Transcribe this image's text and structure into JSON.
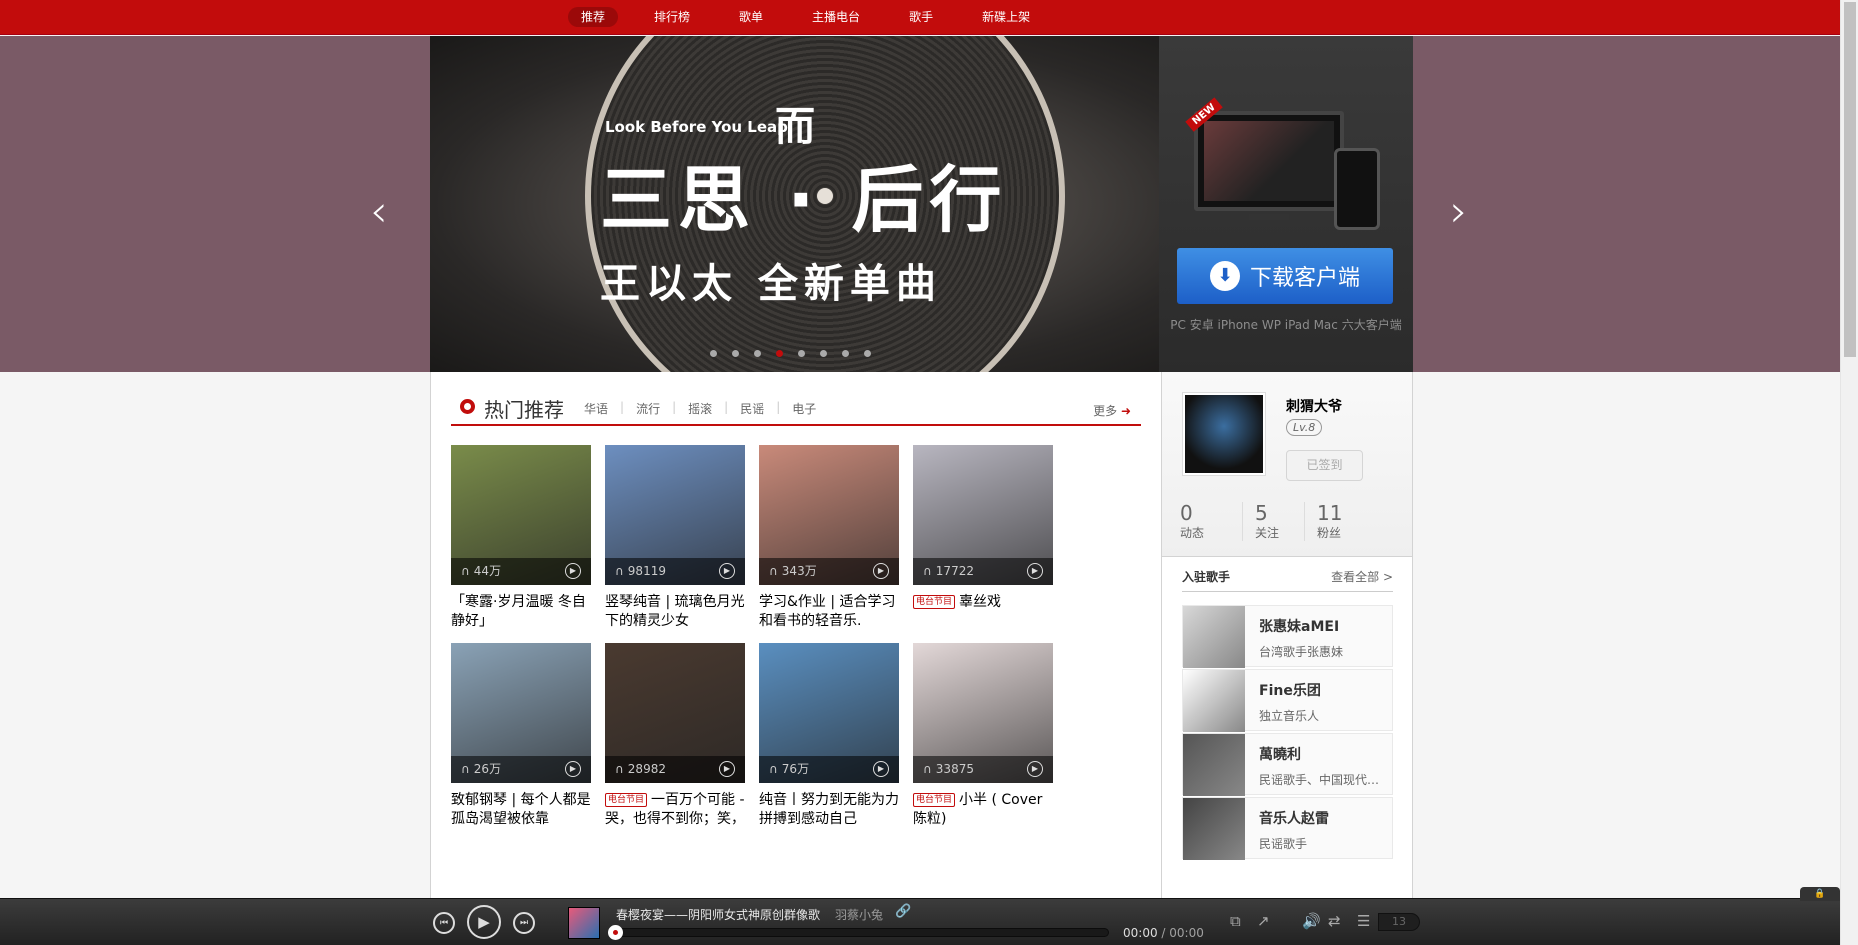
{
  "subnav": {
    "items": [
      "推荐",
      "排行榜",
      "歌单",
      "主播电台",
      "歌手",
      "新碟上架"
    ]
  },
  "banner": {
    "en_text": "Look Before You Leap",
    "er_text": "而",
    "main_text": "三思 · 后行",
    "sub_text": "王以太  全新单曲",
    "prev_arrow": "‹",
    "next_arrow": "›",
    "new_tag": "NEW",
    "download_label": "下载客户端",
    "download_icon": "⬇",
    "download_note": "PC 安卓 iPhone WP iPad Mac 六大客户端",
    "dots": 8,
    "active_dot": 3
  },
  "hot": {
    "title": "热门推荐",
    "tabs": [
      "华语",
      "流行",
      "摇滚",
      "民谣",
      "电子"
    ],
    "more": "更多",
    "more_arrow": "➜",
    "headphone_icon": "∩",
    "play_icon": "▶",
    "radio_tag": "电台节目",
    "cards": [
      {
        "count": "44万",
        "caption": "「寒露·岁月温暖 冬自静好」",
        "radio": false,
        "color": "#7a8c4a"
      },
      {
        "count": "98119",
        "caption": "竖琴纯音 | 琉璃色月光下的精灵少女",
        "radio": false,
        "color": "#6d8fc0"
      },
      {
        "count": "343万",
        "caption": "学习&作业 | 适合学习和看书的轻音乐.",
        "radio": false,
        "color": "#c98a7a"
      },
      {
        "count": "17722",
        "caption": "辜丝戏",
        "radio": true,
        "color": "#b8b6c0"
      },
      {
        "count": "26万",
        "caption": "致郁钢琴 | 每个人都是孤岛渴望被依靠",
        "radio": false,
        "color": "#8aa2b6"
      },
      {
        "count": "28982",
        "caption": "一百万个可能 - 哭，也得不到你；笑，也得不到你",
        "radio": true,
        "color": "#4a3a30"
      },
      {
        "count": "76万",
        "caption": "纯音丨努力到无能为力 拼搏到感动自己",
        "radio": false,
        "color": "#5a8fc0"
      },
      {
        "count": "33875",
        "caption": "小半 ( Cover 陈粒)",
        "radio": true,
        "color": "#e3d8d8"
      }
    ]
  },
  "user": {
    "name": "刺猬大爷",
    "level": "Lv.8",
    "checkin": "已签到",
    "stats": [
      {
        "num": "0",
        "label": "动态"
      },
      {
        "num": "5",
        "label": "关注"
      },
      {
        "num": "11",
        "label": "粉丝"
      }
    ]
  },
  "singers": {
    "title": "入驻歌手",
    "all": "查看全部 >",
    "items": [
      {
        "name": "张惠妹aMEI",
        "desc": "台湾歌手张惠妹",
        "color": "#d8d8d8"
      },
      {
        "name": "Fine乐团",
        "desc": "独立音乐人",
        "color": "#ffffff"
      },
      {
        "name": "萬曉利",
        "desc": "民谣歌手、中国现代民谣的代表人物之一",
        "color": "#555555"
      },
      {
        "name": "音乐人赵雷",
        "desc": "民谣歌手",
        "color": "#444444"
      }
    ]
  },
  "player": {
    "lock_icon": "🔒",
    "prev_icon": "⏮",
    "play_icon": "▶",
    "next_icon": "⏭",
    "title": "春樱夜宴——阴阳师女式神原创群像歌",
    "artist": "羽蔡小兔",
    "link_icon": "🔗",
    "time_now": "00:00",
    "time_total": "/ 00:00",
    "progress": 0,
    "icons": [
      "picture-in-picture",
      "share",
      "volume",
      "loop",
      "playlist"
    ],
    "icon_glyphs": [
      "⧉",
      "↗",
      "🔊",
      "⇄",
      "☰"
    ],
    "playlist_count": "13"
  }
}
